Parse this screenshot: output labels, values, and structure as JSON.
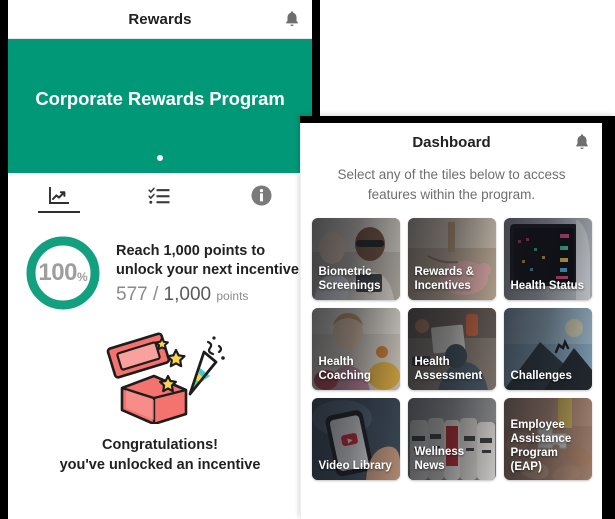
{
  "rewards_phone": {
    "header": {
      "title": "Rewards",
      "bell_icon": "bell-icon"
    },
    "hero": {
      "title": "Corporate Rewards Program",
      "carousel_dot": "•"
    },
    "tabs": [
      {
        "label": "",
        "icon": "chart-line-icon",
        "active": true
      },
      {
        "label": "",
        "icon": "checklist-icon",
        "active": false
      },
      {
        "label": "",
        "icon": "info-circle-icon",
        "active": false
      }
    ],
    "progress": {
      "percent": "100",
      "percent_symbol": "%",
      "headline_line1": "Reach 1,000 points to",
      "headline_line2": "unlock your next incentive",
      "current_points": "577",
      "separator": "/",
      "goal_points": "1,000",
      "points_unit": "points",
      "ring_color": "#13a07f",
      "ring_text_color": "#9e9e9e"
    },
    "congrats": {
      "illustration": "gift-box-confetti-icon",
      "line1": "Congratulations!",
      "line2": "you've unlocked an incentive"
    }
  },
  "dashboard_phone": {
    "header": {
      "title": "Dashboard",
      "bell_icon": "bell-icon"
    },
    "subtitle": "Select any of the tiles below to access features within the program.",
    "tiles": [
      {
        "label": "Biometric Screenings"
      },
      {
        "label": "Rewards & Incentives"
      },
      {
        "label": "Health Status"
      },
      {
        "label": "Health Coaching"
      },
      {
        "label": "Health Assessment"
      },
      {
        "label": "Challenges"
      },
      {
        "label": "Video Library"
      },
      {
        "label": "Wellness News"
      },
      {
        "label": "Employee Assistance Program (EAP)"
      }
    ]
  },
  "theme": {
    "brand_green": "#009877",
    "text_dark": "#212121",
    "text_muted": "#6e6e6e",
    "device_frame": "#000000"
  }
}
